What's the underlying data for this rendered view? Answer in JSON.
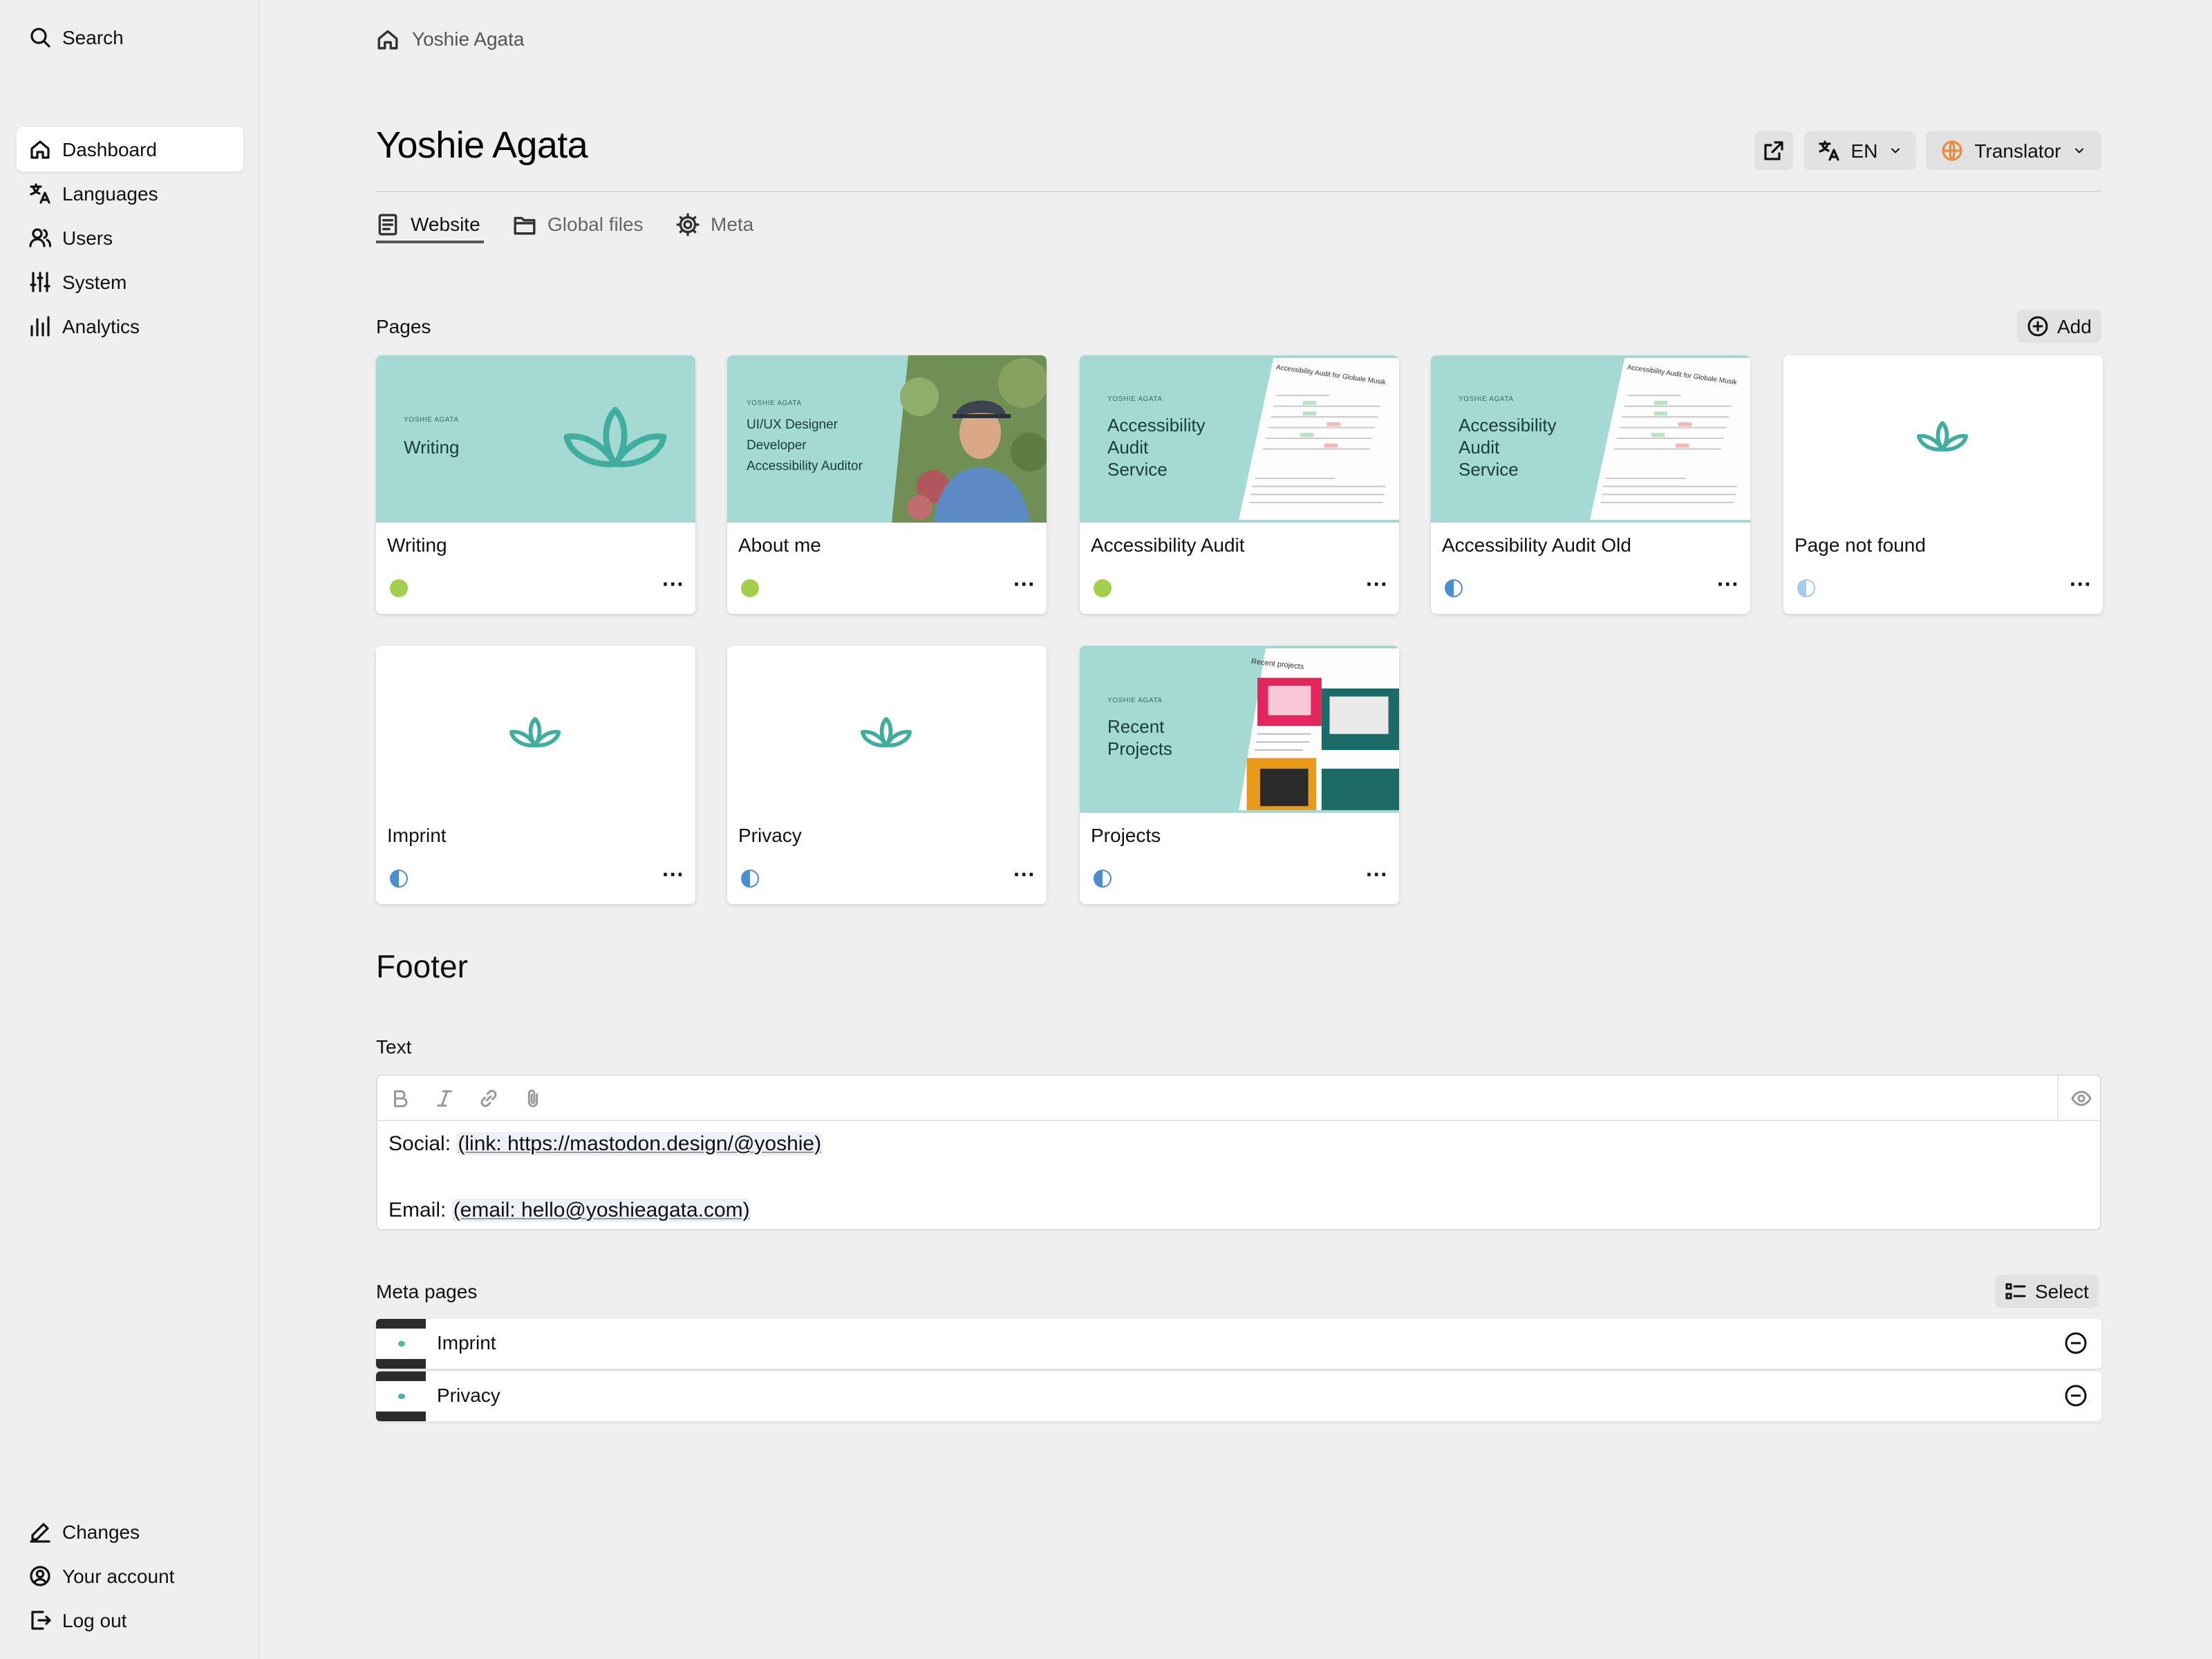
{
  "sidebar": {
    "search_label": "Search",
    "nav": [
      {
        "label": "Dashboard",
        "icon": "home-icon",
        "active": true
      },
      {
        "label": "Languages",
        "icon": "translate-icon"
      },
      {
        "label": "Users",
        "icon": "users-icon"
      },
      {
        "label": "System",
        "icon": "sliders-icon"
      },
      {
        "label": "Analytics",
        "icon": "bar-chart-icon"
      }
    ],
    "bottom": [
      {
        "label": "Changes",
        "icon": "pencil-icon"
      },
      {
        "label": "Your account",
        "icon": "account-icon"
      },
      {
        "label": "Log out",
        "icon": "logout-icon"
      }
    ]
  },
  "breadcrumb": {
    "label": "Yoshie Agata"
  },
  "header": {
    "title": "Yoshie Agata",
    "language": "EN",
    "role": "Translator"
  },
  "tabs": [
    {
      "label": "Website",
      "active": true
    },
    {
      "label": "Global files"
    },
    {
      "label": "Meta"
    }
  ],
  "pages_section": {
    "label": "Pages",
    "add_label": "Add",
    "cards": [
      {
        "title": "Writing",
        "status": "published",
        "thumb_brand": "YOSHIE AGATA",
        "thumb_text": "Writing"
      },
      {
        "title": "About me",
        "status": "published",
        "thumb_brand": "YOSHIE AGATA",
        "thumb_lines": [
          "UI/UX Designer",
          "Developer",
          "Accessibility Auditor"
        ]
      },
      {
        "title": "Accessibility Audit",
        "status": "published",
        "thumb_brand": "YOSHIE AGATA",
        "thumb_lines": [
          "Accessibility",
          "Audit",
          "Service"
        ],
        "thumb_doc_title": "Accessibility Audit for Globale Musik"
      },
      {
        "title": "Accessibility Audit Old",
        "status": "unlisted",
        "thumb_brand": "YOSHIE AGATA",
        "thumb_lines": [
          "Accessibility",
          "Audit",
          "Service"
        ],
        "thumb_doc_title": "Accessibility Audit for Globale Musik"
      },
      {
        "title": "Page not found",
        "status": "unlisted-disabled"
      },
      {
        "title": "Imprint",
        "status": "unlisted"
      },
      {
        "title": "Privacy",
        "status": "unlisted"
      },
      {
        "title": "Projects",
        "status": "unlisted",
        "thumb_brand": "YOSHIE AGATA",
        "thumb_lines": [
          "Recent",
          "Projects"
        ],
        "thumb_doc_title": "Recent projects"
      }
    ]
  },
  "footer_section": {
    "title": "Footer",
    "text_label": "Text",
    "line1_prefix": "Social: ",
    "line1_link": "(link: https://mastodon.design/@yoshie)",
    "line2_prefix": "Email: ",
    "line2_link": "(email: hello@yoshieagata.com)"
  },
  "meta_pages": {
    "label": "Meta pages",
    "select_label": "Select",
    "items": [
      {
        "label": "Imprint"
      },
      {
        "label": "Privacy"
      }
    ]
  },
  "colors": {
    "teal_bg": "#a4dad3",
    "lotus": "#4db3a8",
    "published": "#a3cd4a",
    "unlisted": "#4b8ed0"
  }
}
